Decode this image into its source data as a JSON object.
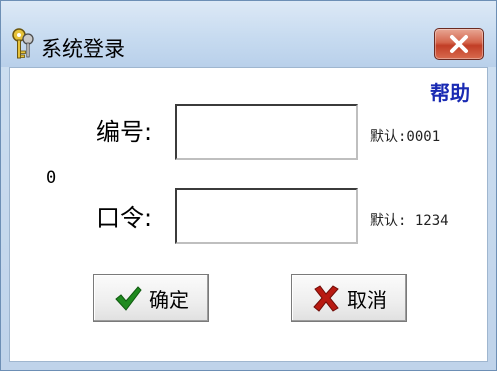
{
  "window": {
    "title": "系统登录",
    "icon": "keys-icon",
    "close_icon": "close-icon"
  },
  "help": {
    "label": "帮助"
  },
  "side_value": "0",
  "fields": {
    "code": {
      "label": "编号:",
      "value": "",
      "hint": "默认:0001"
    },
    "password": {
      "label": "口令:",
      "value": "",
      "hint": "默认: 1234"
    }
  },
  "buttons": {
    "ok": {
      "label": "确定",
      "icon": "checkmark-icon"
    },
    "cancel": {
      "label": "取消",
      "icon": "x-mark-icon"
    }
  },
  "colors": {
    "title_bar": "#c7dbf0",
    "close_button": "#c13e26",
    "help_link": "#1a2bb3",
    "checkmark": "#1f8a1f",
    "x_mark": "#b81a12"
  }
}
